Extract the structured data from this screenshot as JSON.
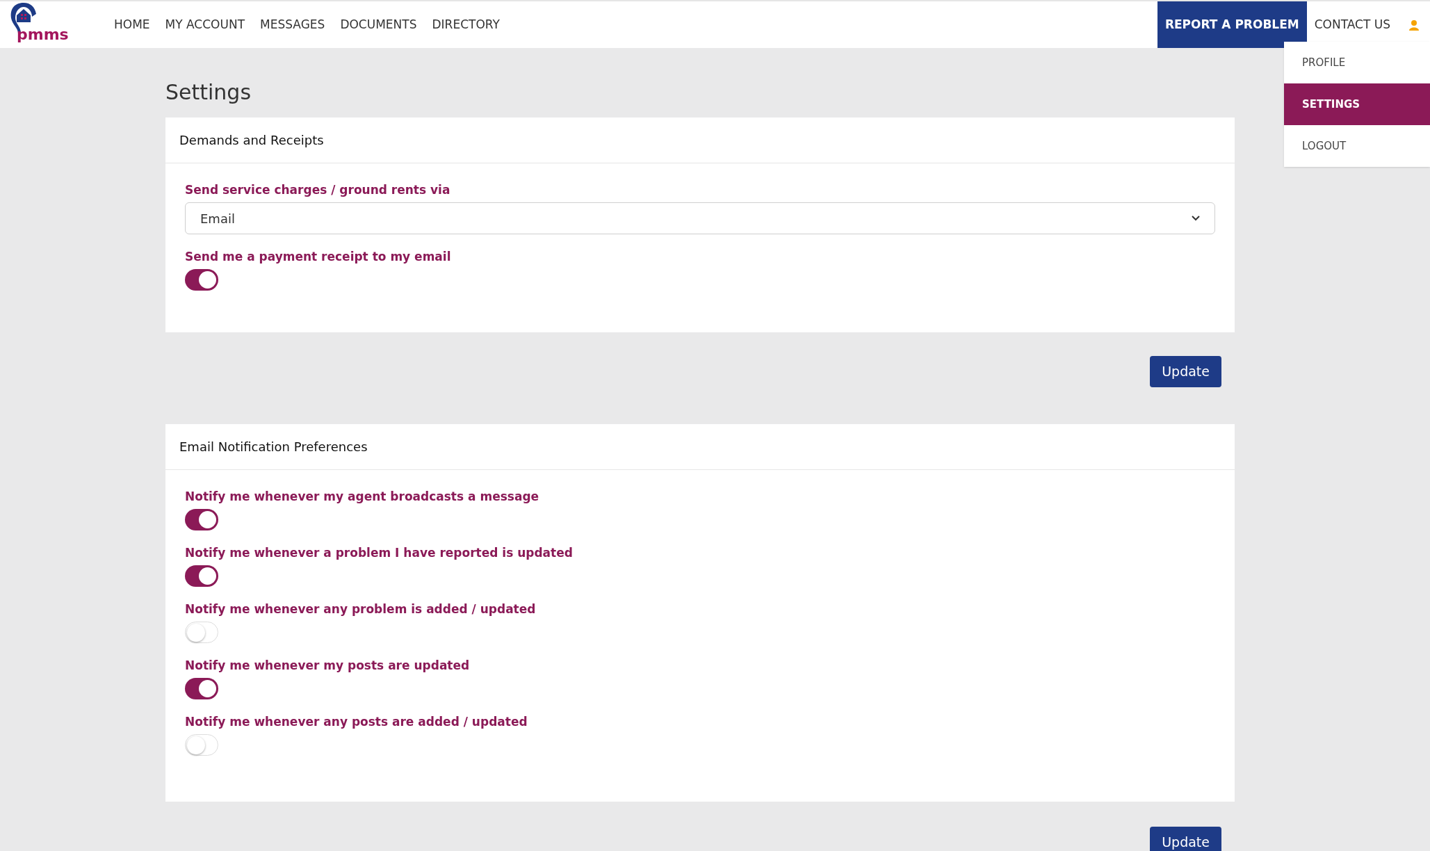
{
  "logo": {
    "text": "pmms"
  },
  "nav": [
    {
      "label": "HOME"
    },
    {
      "label": "MY ACCOUNT"
    },
    {
      "label": "MESSAGES"
    },
    {
      "label": "DOCUMENTS"
    },
    {
      "label": "DIRECTORY"
    }
  ],
  "nav_right": [
    {
      "label": "REPORT A PROBLEM",
      "kind": "primary"
    },
    {
      "label": "CONTACT US",
      "kind": "link"
    }
  ],
  "user_menu": [
    {
      "label": "PROFILE",
      "selected": false
    },
    {
      "label": "SETTINGS",
      "selected": true
    },
    {
      "label": "LOGOUT",
      "selected": false
    }
  ],
  "page_title": "Settings",
  "sections": [
    {
      "title": "Demands and Receipts",
      "fields": [
        {
          "kind": "select",
          "label": "Send service charges / ground rents via",
          "value": "Email"
        },
        {
          "kind": "toggle",
          "label": "Send me a payment receipt to my email",
          "on": true
        }
      ],
      "button": "Update"
    },
    {
      "title": "Email Notification Preferences",
      "fields": [
        {
          "kind": "toggle",
          "label": "Notify me whenever my agent broadcasts a message",
          "on": true
        },
        {
          "kind": "toggle",
          "label": "Notify me whenever a problem I have reported is updated",
          "on": true
        },
        {
          "kind": "toggle",
          "label": "Notify me whenever any problem is added / updated",
          "on": false
        },
        {
          "kind": "toggle",
          "label": "Notify me whenever my posts are updated",
          "on": true
        },
        {
          "kind": "toggle",
          "label": "Notify me whenever any posts are added / updated",
          "on": false
        }
      ],
      "button": "Update"
    }
  ]
}
